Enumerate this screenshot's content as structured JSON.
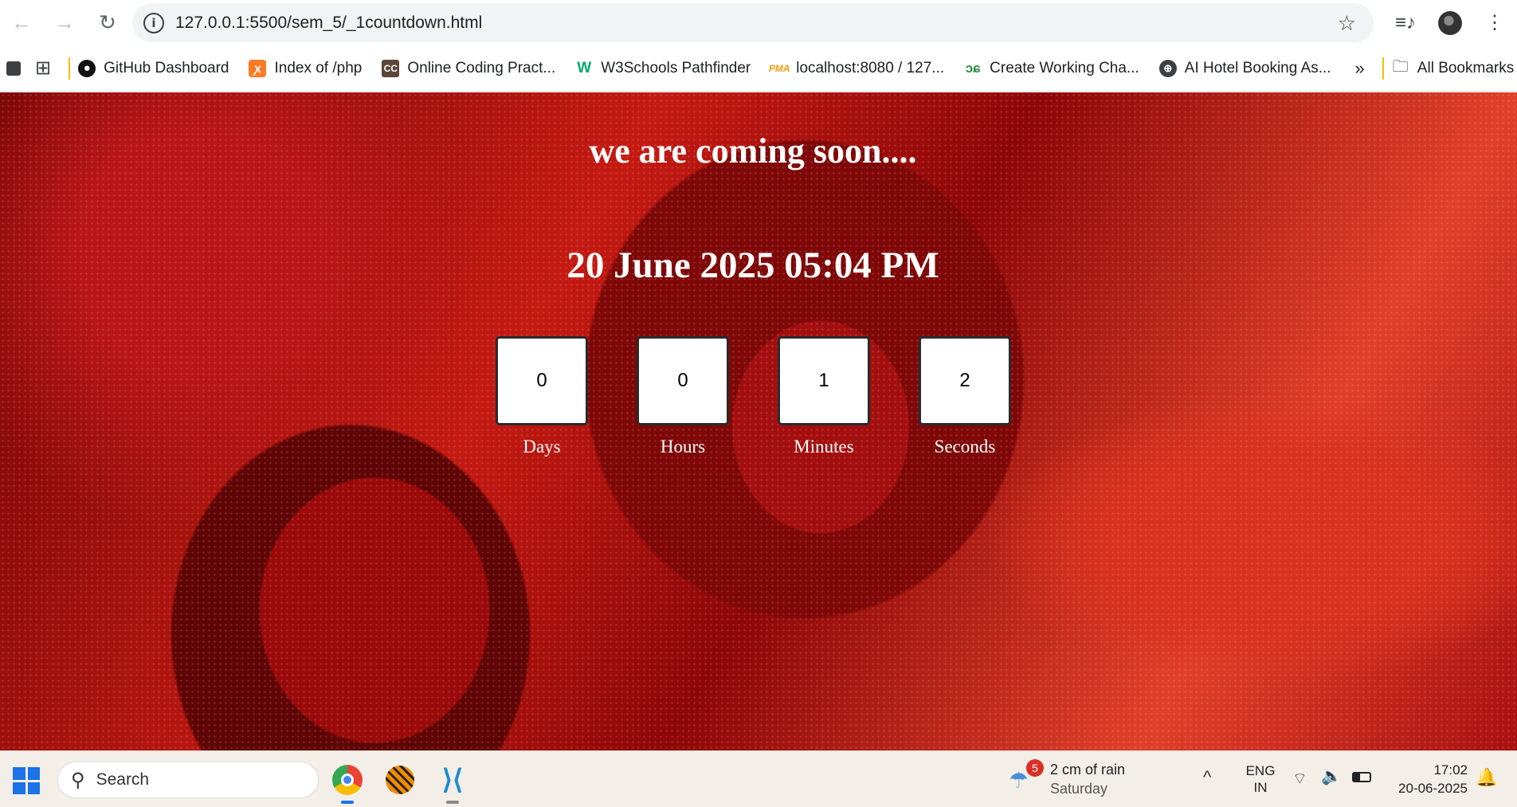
{
  "browser": {
    "url": "127.0.0.1:5500/sem_5/_1countdown.html",
    "bookmarks": [
      {
        "label": "GitHub Dashboard",
        "icon": "github-icon"
      },
      {
        "label": "Index of /php",
        "icon": "xampp-icon"
      },
      {
        "label": "Online Coding Pract...",
        "icon": "codechef-icon"
      },
      {
        "label": "W3Schools Pathfinder",
        "icon": "w3schools-icon"
      },
      {
        "label": "localhost:8080 / 127...",
        "icon": "phpmyadmin-icon"
      },
      {
        "label": "Create Working Cha...",
        "icon": "geeksforgeeks-icon"
      },
      {
        "label": "AI Hotel Booking As...",
        "icon": "globe-icon"
      }
    ],
    "more_label": "»",
    "all_bookmarks": "All Bookmarks"
  },
  "page": {
    "title": "we are coming soon....",
    "target_datetime": "20 June 2025 05:04 PM",
    "countdown": [
      {
        "value": "0",
        "label": "Days"
      },
      {
        "value": "0",
        "label": "Hours"
      },
      {
        "value": "1",
        "label": "Minutes"
      },
      {
        "value": "2",
        "label": "Seconds"
      }
    ]
  },
  "taskbar": {
    "search_placeholder": "Search",
    "weather_badge": "5",
    "weather_line1": "2 cm of rain",
    "weather_line2": "Saturday",
    "lang_line1": "ENG",
    "lang_line2": "IN",
    "time": "17:02",
    "date": "20-06-2025"
  }
}
